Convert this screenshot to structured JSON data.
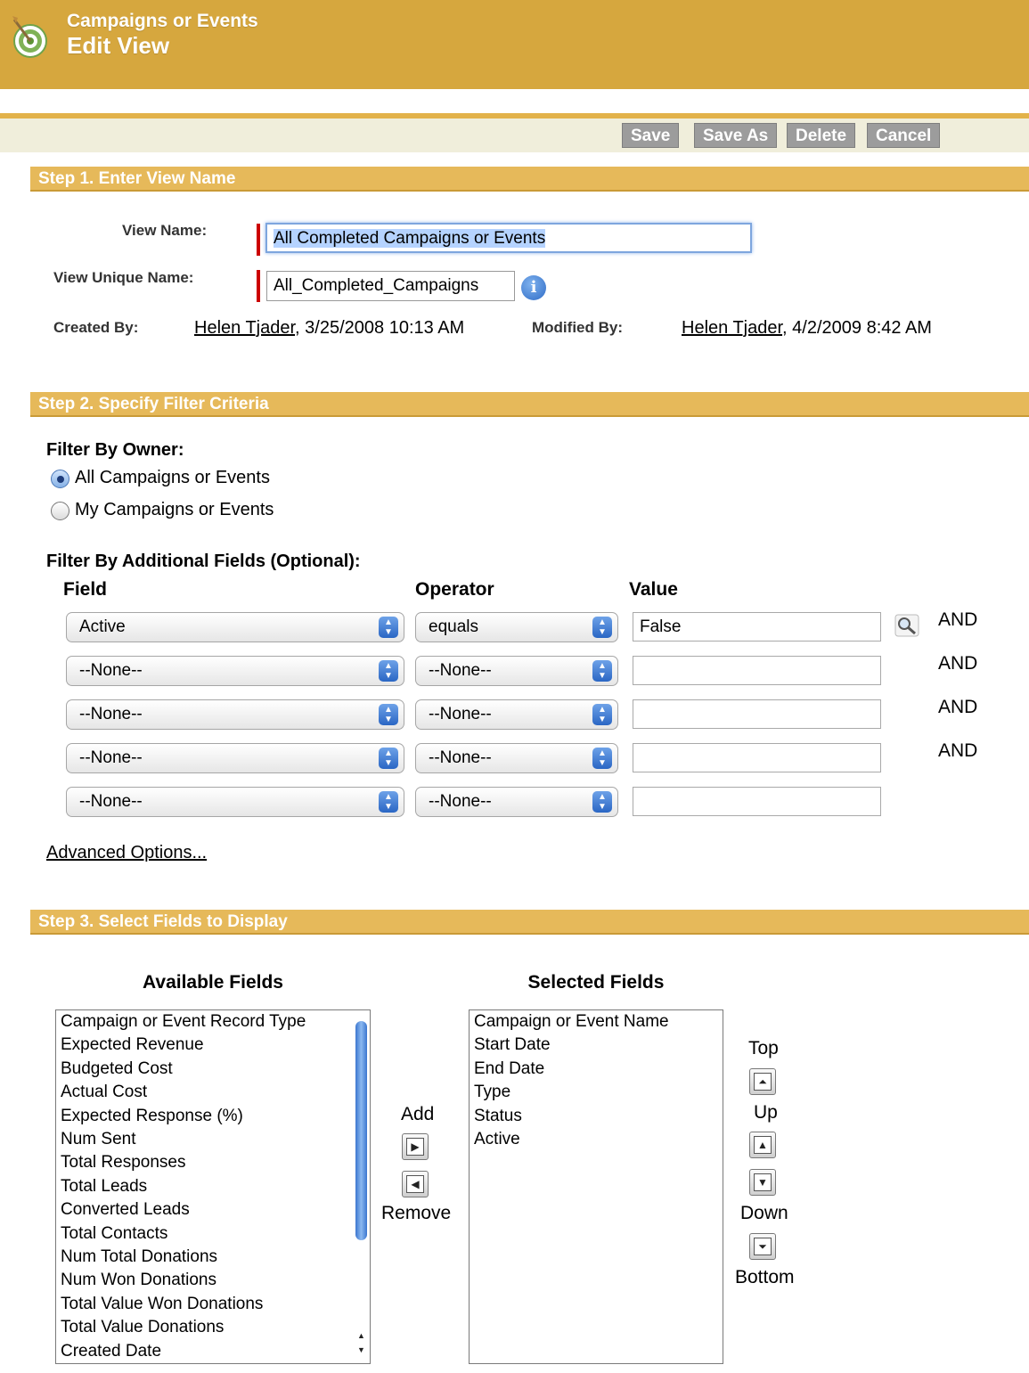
{
  "header": {
    "object_type": "Campaigns or Events",
    "view_title": "Edit View"
  },
  "toolbar": {
    "save_label": "Save",
    "save_as_label": "Save As",
    "delete_label": "Delete",
    "cancel_label": "Cancel"
  },
  "step1": {
    "title": "Step 1. Enter View Name",
    "view_name_label": "View Name:",
    "view_name_value": "All Completed Campaigns or Events",
    "unique_name_label": "View Unique Name:",
    "unique_name_value": "All_Completed_Campaigns",
    "created_by_label": "Created By:",
    "created_by_user": "Helen Tjader",
    "created_by_date": ", 3/25/2008 10:13 AM",
    "modified_by_label": "Modified By:",
    "modified_by_user": "Helen Tjader",
    "modified_by_date": ", 4/2/2009 8:42 AM"
  },
  "step2": {
    "title": "Step 2. Specify Filter Criteria",
    "filter_owner_label": "Filter By Owner:",
    "owner_options": [
      "All Campaigns or Events",
      "My Campaigns or Events"
    ],
    "owner_selected": "All Campaigns or Events",
    "additional_label": "Filter By Additional Fields (Optional):",
    "col_field": "Field",
    "col_operator": "Operator",
    "col_value": "Value",
    "rows": [
      {
        "field": "Active",
        "operator": "equals",
        "value": "False",
        "conj": "AND"
      },
      {
        "field": "--None--",
        "operator": "--None--",
        "value": "",
        "conj": "AND"
      },
      {
        "field": "--None--",
        "operator": "--None--",
        "value": "",
        "conj": "AND"
      },
      {
        "field": "--None--",
        "operator": "--None--",
        "value": "",
        "conj": "AND"
      },
      {
        "field": "--None--",
        "operator": "--None--",
        "value": "",
        "conj": ""
      }
    ],
    "advanced_link": "Advanced Options..."
  },
  "step3": {
    "title": "Step 3. Select Fields to Display",
    "available_title": "Available Fields",
    "selected_title": "Selected Fields",
    "available": [
      "Campaign or Event Record Type",
      "Expected Revenue",
      "Budgeted Cost",
      "Actual Cost",
      "Expected Response (%)",
      "Num Sent",
      "Total Responses",
      "Total Leads",
      "Converted Leads",
      "Total Contacts",
      "Num Total Donations",
      "Num Won Donations",
      "Total Value Won Donations",
      "Total Value Donations",
      "Created Date"
    ],
    "selected": [
      "Campaign or Event Name",
      "Start Date",
      "End Date",
      "Type",
      "Status",
      "Active"
    ],
    "add_label": "Add",
    "remove_label": "Remove",
    "top_label": "Top",
    "up_label": "Up",
    "down_label": "Down",
    "bottom_label": "Bottom"
  },
  "colors": {
    "header_bg": "#d6a73e",
    "section_bg": "#e6b95a",
    "button_bg": "#9c9c9c",
    "required": "#cc0000"
  }
}
